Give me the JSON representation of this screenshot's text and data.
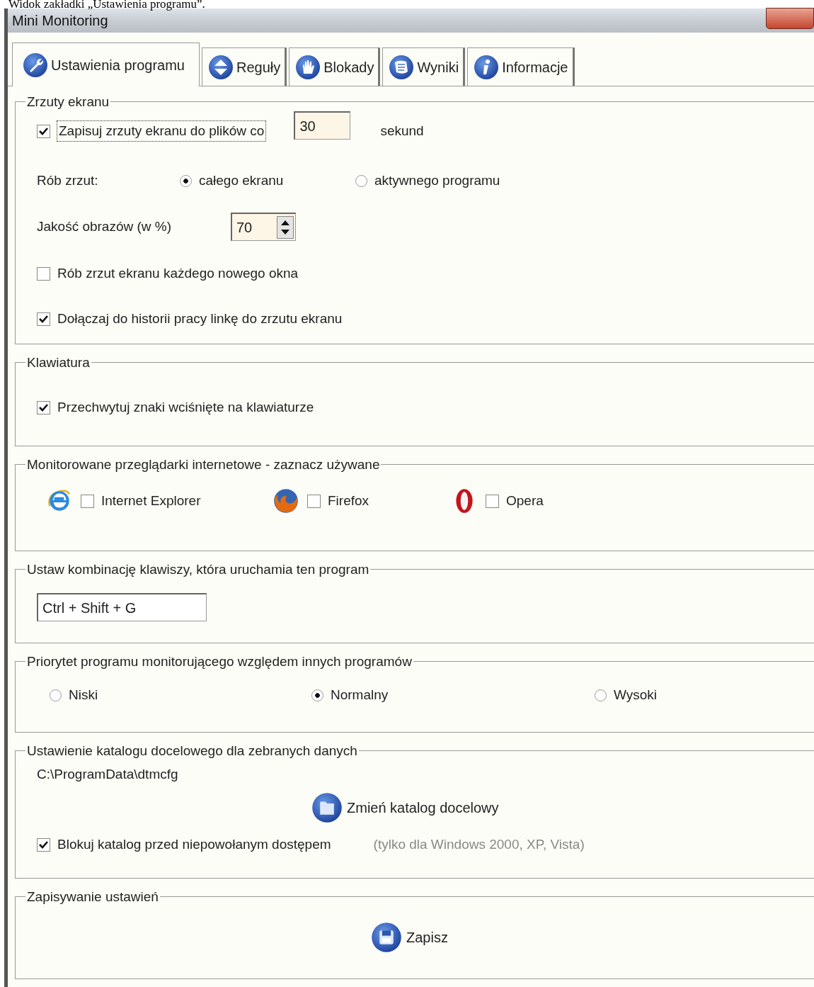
{
  "caption": "Widok zakładki „Ustawienia programu”.",
  "window": {
    "title": "Mini Monitoring"
  },
  "tabs": [
    {
      "label": "Ustawienia programu",
      "selected": true
    },
    {
      "label": "Reguły",
      "selected": false
    },
    {
      "label": "Blokady",
      "selected": false
    },
    {
      "label": "Wyniki",
      "selected": false
    },
    {
      "label": "Informacje",
      "selected": false
    }
  ],
  "screenshots": {
    "title": "Zrzuty ekranu",
    "save_periodically": {
      "label": "Zapisuj zrzuty ekranu do plików co",
      "checked": true,
      "focused": true
    },
    "interval": "30",
    "interval_unit": "sekund",
    "capture_label": "Rób zrzut:",
    "capture_options": [
      {
        "label": "całego ekranu",
        "selected": true
      },
      {
        "label": "aktywnego programu",
        "selected": false
      }
    ],
    "quality_label": "Jakość obrazów (w %)",
    "quality": "70",
    "new_window": {
      "label": "Rób zrzut ekranu każdego nowego okna",
      "checked": false
    },
    "attach_link": {
      "label": "Dołączaj do historii pracy linkę do zrzutu ekranu",
      "checked": true
    }
  },
  "keyboard": {
    "title": "Klawiatura",
    "capture_keys": {
      "label": "Przechwytuj znaki wciśnięte na klawiaturze",
      "checked": true
    }
  },
  "browsers": {
    "title": "Monitorowane przeglądarki internetowe - zaznacz używane",
    "items": [
      {
        "label": "Internet Explorer",
        "checked": false
      },
      {
        "label": "Firefox",
        "checked": false
      },
      {
        "label": "Opera",
        "checked": false
      }
    ]
  },
  "hotkey": {
    "title": "Ustaw kombinację klawiszy, która uruchamia ten program",
    "value": "Ctrl + Shift + G"
  },
  "priority": {
    "title": "Priorytet programu monitorującego względem innych programów",
    "options": [
      {
        "label": "Niski",
        "selected": false
      },
      {
        "label": "Normalny",
        "selected": true
      },
      {
        "label": "Wysoki",
        "selected": false
      }
    ]
  },
  "directory": {
    "title": "Ustawienie katalogu docelowego dla zebranych danych",
    "path": "C:\\ProgramData\\dtmcfg",
    "change_button": "Zmień katalog docelowy",
    "lock": {
      "label": "Blokuj katalog przed niepowołanym dostępem",
      "checked": true
    },
    "note": "(tylko dla Windows 2000, XP, Vista)"
  },
  "save": {
    "title": "Zapisywanie ustawień",
    "button": "Zapisz"
  }
}
